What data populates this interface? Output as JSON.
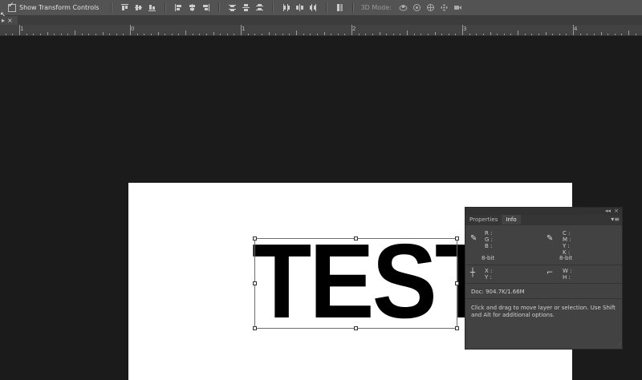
{
  "options_bar": {
    "show_transform_controls_label": "Show Transform Controls",
    "mode_label": "3D Mode:"
  },
  "document_tab": {
    "close_glyph": "×",
    "menu_glyph": "▸"
  },
  "ruler": {
    "labels": [
      "1",
      "0",
      "1",
      "2",
      "3",
      "4"
    ]
  },
  "canvas": {
    "text_layer": "TEST"
  },
  "info_panel": {
    "collapse_glyph": "◂◂",
    "close_glyph": "×",
    "tabs": [
      "Properties",
      "Info"
    ],
    "active_tab": "Info",
    "menu_glyph": "▾≡",
    "rgb_labels": [
      "R :",
      "G :",
      "B :"
    ],
    "rgb_bit": "8-bit",
    "cmyk_labels": [
      "C :",
      "M :",
      "Y :",
      "K :"
    ],
    "cmyk_bit": "8-bit",
    "xy_labels": [
      "X :",
      "Y :"
    ],
    "wh_labels": [
      "W :",
      "H :"
    ],
    "doc_size": "Doc: 904.7K/1.66M",
    "hint": "Click and drag to move layer or selection.  Use Shift and Alt for additional options."
  },
  "colors": {
    "workspace": "#1b1b1b",
    "options_bar": "#535353",
    "panel": "#424242",
    "document": "#ffffff"
  }
}
